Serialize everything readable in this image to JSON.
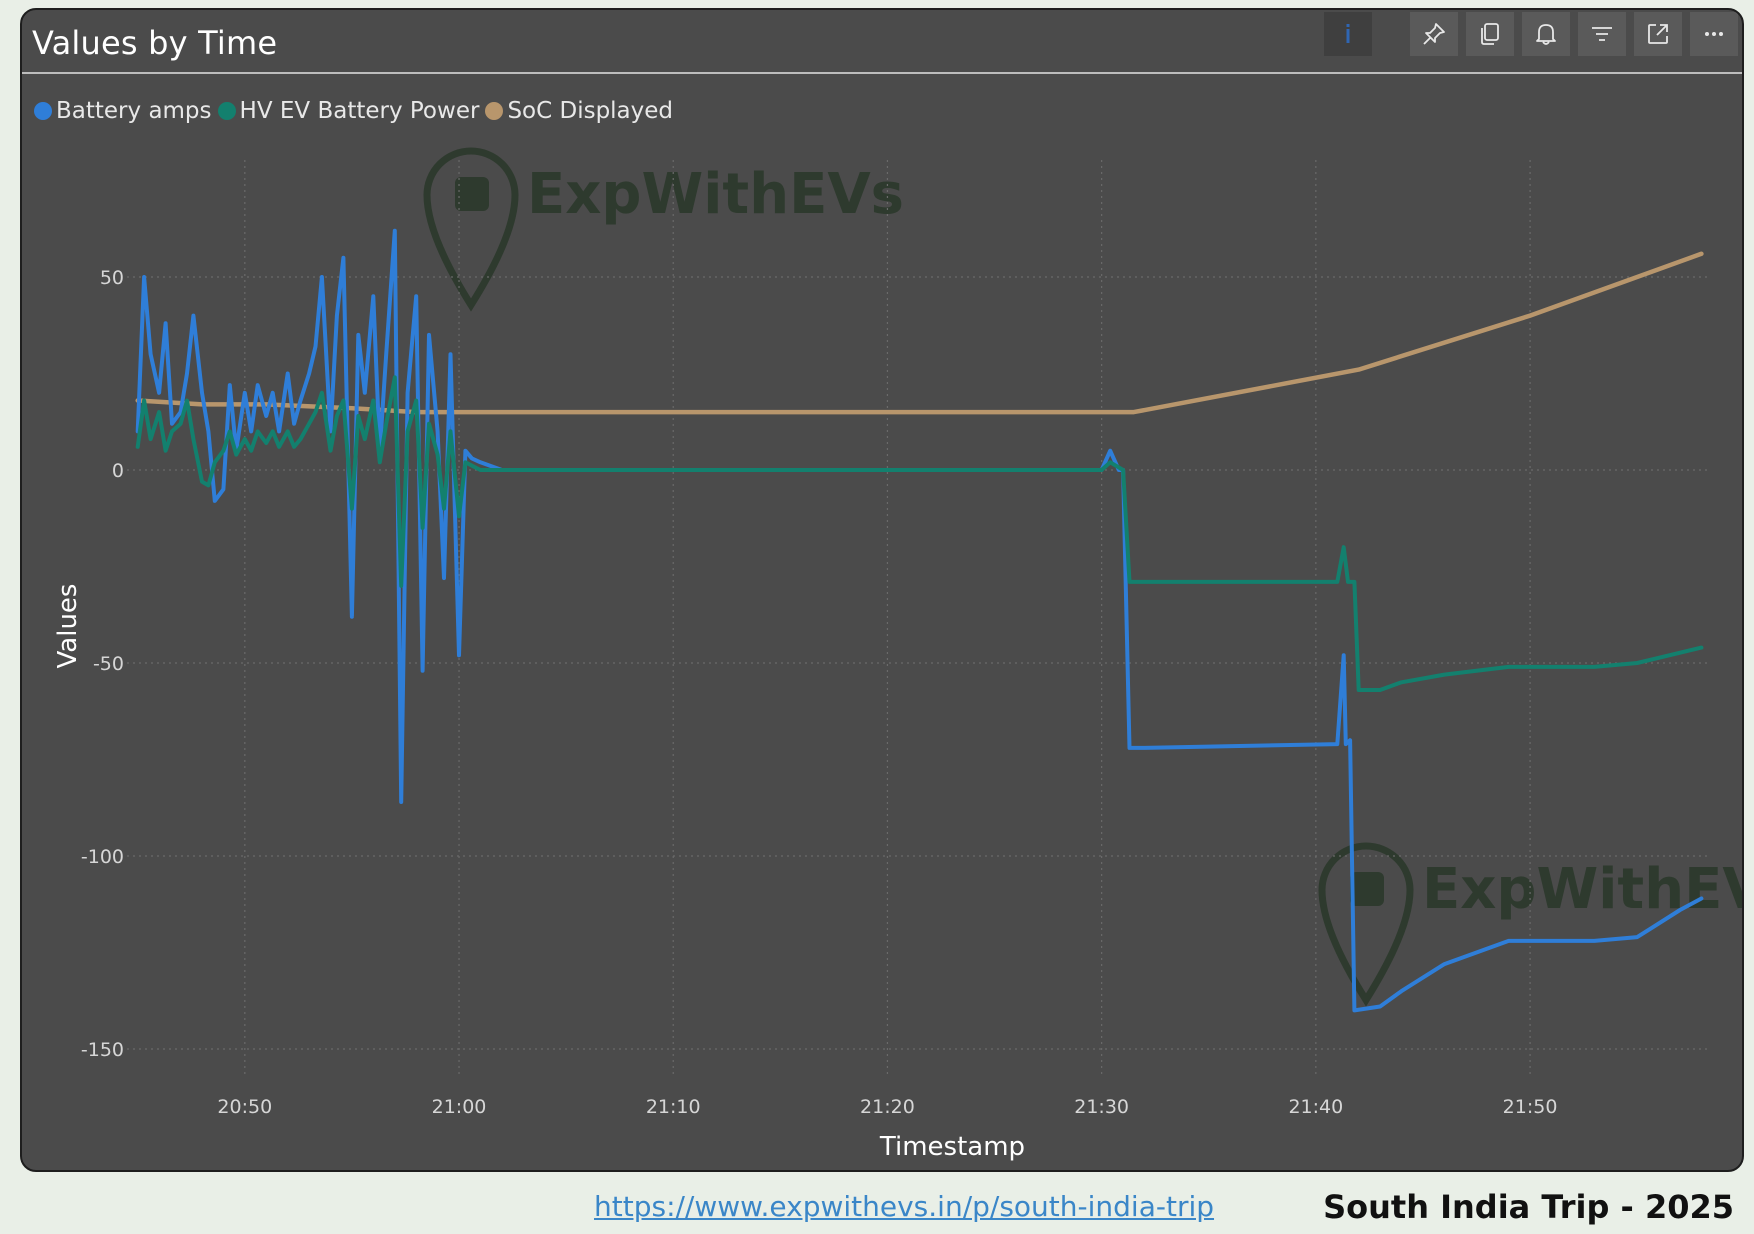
{
  "card": {
    "title": "Values by Time",
    "toolbar": [
      {
        "name": "info-icon"
      },
      {
        "name": "pin-icon"
      },
      {
        "name": "copy-icon"
      },
      {
        "name": "bell-icon"
      },
      {
        "name": "filter-icon"
      },
      {
        "name": "focus-mode-icon"
      },
      {
        "name": "more-options-icon"
      }
    ]
  },
  "footer": {
    "link": "https://www.expwithevs.in/p/south-india-trip",
    "brand": "South India Trip - 2025"
  },
  "watermark": {
    "text": "ExpWithEVs"
  },
  "colors": {
    "background": "#e9efe7",
    "card": "#4b4b4b",
    "battery_amps": "#2f7ed8",
    "hv_power": "#13806e",
    "soc": "#b8966c",
    "watermark": "#2e3a2e",
    "link": "#3a86c8"
  },
  "chart_data": {
    "type": "line",
    "title": "Values by Time",
    "xlabel": "Timestamp",
    "ylabel": "Values",
    "x_tick_labels": [
      "20:50",
      "21:00",
      "21:10",
      "21:20",
      "21:30",
      "21:40",
      "21:50"
    ],
    "y_tick_labels": [
      "50",
      "0",
      "-50",
      "-100",
      "-150"
    ],
    "x_range_minutes": [
      "20:45",
      "21:58"
    ],
    "ylim": [
      -160,
      70
    ],
    "grid": true,
    "legend_position": "top-left",
    "series": [
      {
        "name": "Battery amps",
        "color": "#2f7ed8",
        "points": [
          [
            "20:45",
            10
          ],
          [
            "20:45.3",
            50
          ],
          [
            "20:45.6",
            30
          ],
          [
            "20:46",
            20
          ],
          [
            "20:46.3",
            38
          ],
          [
            "20:46.6",
            12
          ],
          [
            "20:47",
            15
          ],
          [
            "20:47.3",
            25
          ],
          [
            "20:47.6",
            40
          ],
          [
            "20:48",
            20
          ],
          [
            "20:48.3",
            10
          ],
          [
            "20:48.6",
            -8
          ],
          [
            "20:49",
            -5
          ],
          [
            "20:49.3",
            22
          ],
          [
            "20:49.6",
            5
          ],
          [
            "20:50",
            20
          ],
          [
            "20:50.3",
            10
          ],
          [
            "20:50.6",
            22
          ],
          [
            "20:51",
            14
          ],
          [
            "20:51.3",
            20
          ],
          [
            "20:51.6",
            10
          ],
          [
            "20:52",
            25
          ],
          [
            "20:52.3",
            12
          ],
          [
            "20:52.6",
            18
          ],
          [
            "20:53",
            25
          ],
          [
            "20:53.3",
            32
          ],
          [
            "20:53.6",
            50
          ],
          [
            "20:54",
            10
          ],
          [
            "20:54.3",
            40
          ],
          [
            "20:54.6",
            55
          ],
          [
            "20:55",
            -38
          ],
          [
            "20:55.3",
            35
          ],
          [
            "20:55.6",
            20
          ],
          [
            "20:56",
            45
          ],
          [
            "20:56.3",
            5
          ],
          [
            "20:56.6",
            30
          ],
          [
            "20:57",
            62
          ],
          [
            "20:57.3",
            -86
          ],
          [
            "20:57.6",
            20
          ],
          [
            "20:58",
            45
          ],
          [
            "20:58.3",
            -52
          ],
          [
            "20:58.6",
            35
          ],
          [
            "20:59",
            10
          ],
          [
            "20:59.3",
            -28
          ],
          [
            "20:59.6",
            30
          ],
          [
            "21:00",
            -48
          ],
          [
            "21:00.3",
            5
          ],
          [
            "21:00.6",
            3
          ],
          [
            "21:01",
            2
          ],
          [
            "21:02",
            0
          ],
          [
            "21:30",
            0
          ],
          [
            "21:30.4",
            5
          ],
          [
            "21:30.8",
            0
          ],
          [
            "21:31",
            0
          ],
          [
            "21:31.3",
            -72
          ],
          [
            "21:32",
            -72
          ],
          [
            "21:41",
            -71
          ],
          [
            "21:41.3",
            -48
          ],
          [
            "21:41.4",
            -71
          ],
          [
            "21:41.6",
            -70
          ],
          [
            "21:41.8",
            -140
          ],
          [
            "21:43",
            -139
          ],
          [
            "21:44",
            -135
          ],
          [
            "21:46",
            -128
          ],
          [
            "21:49",
            -122
          ],
          [
            "21:53",
            -122
          ],
          [
            "21:55",
            -121
          ],
          [
            "21:57",
            -114
          ],
          [
            "21:58",
            -111
          ]
        ]
      },
      {
        "name": "HV EV Battery Power",
        "color": "#13806e",
        "points": [
          [
            "20:45",
            6
          ],
          [
            "20:45.3",
            18
          ],
          [
            "20:45.6",
            8
          ],
          [
            "20:46",
            15
          ],
          [
            "20:46.3",
            5
          ],
          [
            "20:46.6",
            10
          ],
          [
            "20:47",
            12
          ],
          [
            "20:47.3",
            18
          ],
          [
            "20:47.6",
            8
          ],
          [
            "20:48",
            -3
          ],
          [
            "20:48.3",
            -4
          ],
          [
            "20:48.6",
            2
          ],
          [
            "20:49",
            5
          ],
          [
            "20:49.3",
            10
          ],
          [
            "20:49.6",
            4
          ],
          [
            "20:50",
            8
          ],
          [
            "20:50.3",
            5
          ],
          [
            "20:50.6",
            10
          ],
          [
            "20:51",
            7
          ],
          [
            "20:51.3",
            10
          ],
          [
            "20:51.6",
            6
          ],
          [
            "20:52",
            10
          ],
          [
            "20:52.3",
            6
          ],
          [
            "20:52.6",
            8
          ],
          [
            "20:53",
            12
          ],
          [
            "20:53.3",
            15
          ],
          [
            "20:53.6",
            20
          ],
          [
            "20:54",
            5
          ],
          [
            "20:54.3",
            14
          ],
          [
            "20:54.6",
            18
          ],
          [
            "20:55",
            -10
          ],
          [
            "20:55.3",
            14
          ],
          [
            "20:55.6",
            8
          ],
          [
            "20:56",
            18
          ],
          [
            "20:56.3",
            2
          ],
          [
            "20:56.6",
            12
          ],
          [
            "20:57",
            24
          ],
          [
            "20:57.3",
            -30
          ],
          [
            "20:57.6",
            10
          ],
          [
            "20:58",
            18
          ],
          [
            "20:58.3",
            -15
          ],
          [
            "20:58.6",
            12
          ],
          [
            "20:59",
            4
          ],
          [
            "20:59.3",
            -10
          ],
          [
            "20:59.6",
            10
          ],
          [
            "21:00",
            -12
          ],
          [
            "21:00.3",
            2
          ],
          [
            "21:01",
            0
          ],
          [
            "21:30",
            0
          ],
          [
            "21:30.4",
            2
          ],
          [
            "21:31",
            0
          ],
          [
            "21:31.3",
            -29
          ],
          [
            "21:32",
            -29
          ],
          [
            "21:41",
            -29
          ],
          [
            "21:41.3",
            -20
          ],
          [
            "21:41.5",
            -29
          ],
          [
            "21:41.8",
            -29
          ],
          [
            "21:42",
            -57
          ],
          [
            "21:43",
            -57
          ],
          [
            "21:44",
            -55
          ],
          [
            "21:46",
            -53
          ],
          [
            "21:49",
            -51
          ],
          [
            "21:53",
            -51
          ],
          [
            "21:55",
            -50
          ],
          [
            "21:58",
            -46
          ]
        ]
      },
      {
        "name": "SoC Displayed",
        "color": "#b8966c",
        "points": [
          [
            "20:45",
            18
          ],
          [
            "20:48",
            17
          ],
          [
            "20:51",
            17
          ],
          [
            "20:55",
            16
          ],
          [
            "20:58",
            15
          ],
          [
            "21:31.5",
            15
          ],
          [
            "21:42",
            26
          ],
          [
            "21:50",
            40
          ],
          [
            "21:58",
            56
          ]
        ]
      }
    ]
  }
}
